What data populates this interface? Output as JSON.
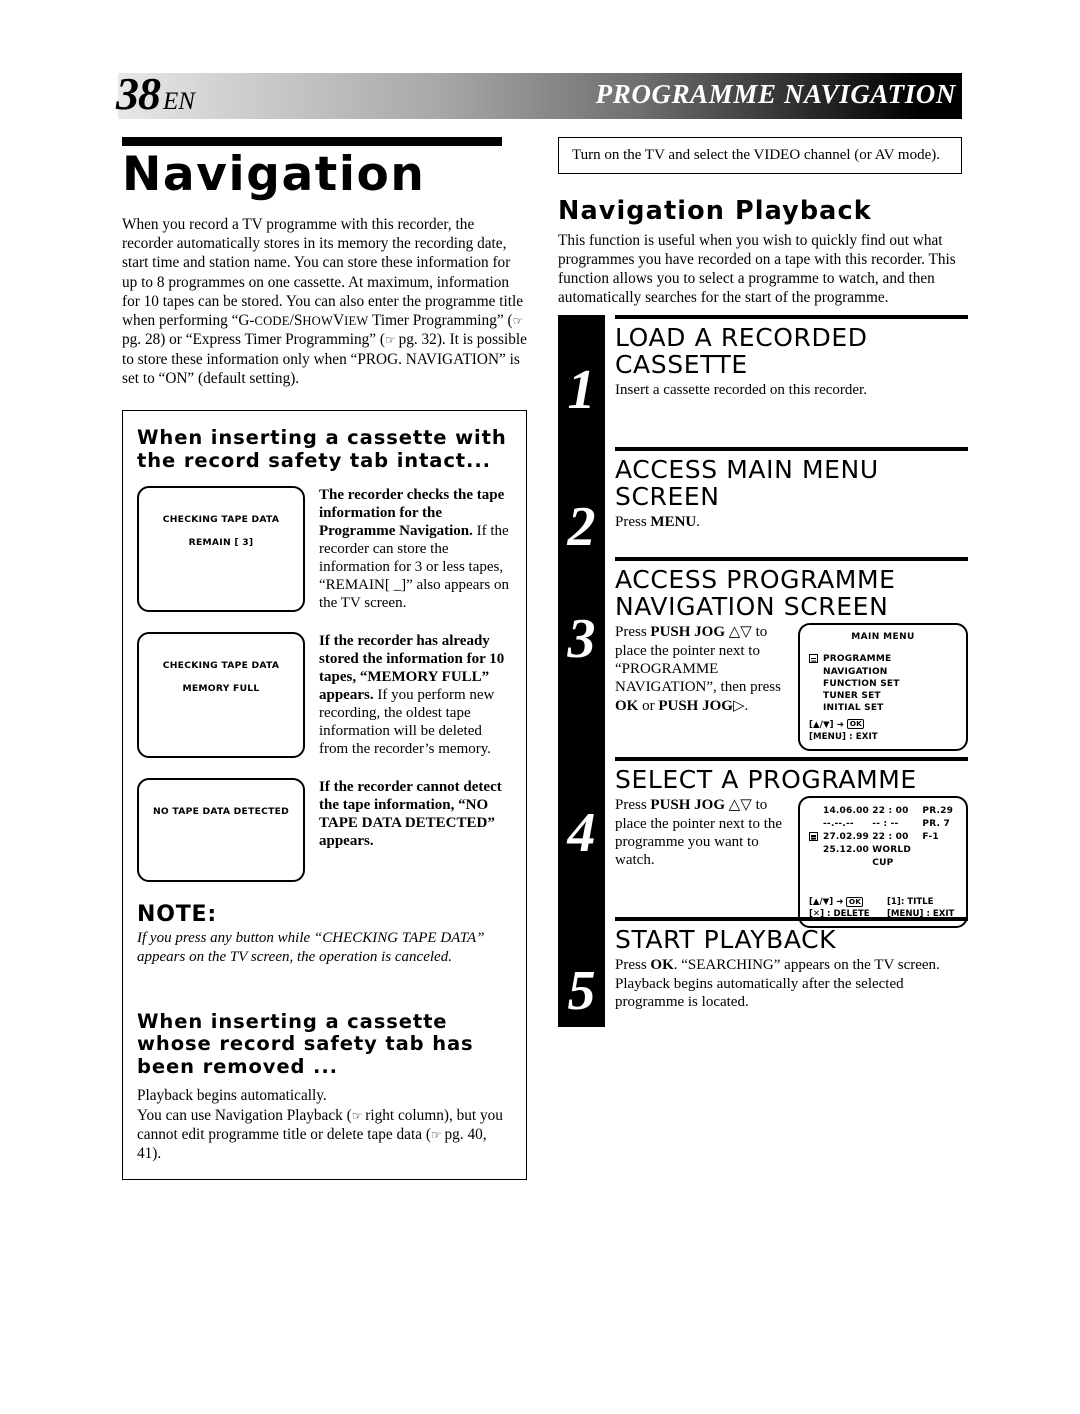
{
  "header": {
    "page_number": "38",
    "lang": "EN",
    "title": "PROGRAMME NAVIGATION"
  },
  "left": {
    "chapter_title": "Navigation",
    "intro_part1": "When you record a TV programme with this recorder, the recorder automatically stores in its memory the recording date, start time and station name. You can store these information for up to 8 programmes on one cassette. At maximum, information for 10 tapes can be stored. You can also enter the programme title when performing “G-",
    "intro_sc1": "CODE",
    "intro_mid1": "/S",
    "intro_sc2": "HOW",
    "intro_mid2": "V",
    "intro_sc3": "IEW",
    "intro_part2": " Timer Programming” (",
    "intro_part3": " pg. 28) or “Express Timer Programming” (",
    "intro_part4": " pg. 32). It is possible to store these information only when “PROG. NAVIGATION” is set to “ON” (default setting).",
    "box": {
      "heading": "When inserting a cassette with the record safety tab intact...",
      "cases": [
        {
          "screen_line1": "CHECKING TAPE DATA",
          "screen_line2": "REMAIN [ 3]",
          "bold_text": "The recorder checks the tape information for the Programme Navigation.",
          "normal_text": "If the recorder can store the information for 3 or less tapes, “REMAIN[ _]” also appears on the TV screen."
        },
        {
          "screen_line1": "CHECKING TAPE DATA",
          "screen_line2": "MEMORY FULL",
          "bold_text": "If the recorder has already stored the information for 10 tapes, “MEMORY FULL” appears.",
          "normal_text": "If you perform new recording, the oldest tape information will be deleted from the recorder’s memory."
        },
        {
          "screen_line1": "NO TAPE DATA DETECTED",
          "screen_line2": "",
          "bold_text": "If the recorder cannot detect the tape information, “NO TAPE DATA DETECTED” appears.",
          "normal_text": ""
        }
      ],
      "note_label": "NOTE:",
      "note_text": "If you press any button while “CHECKING TAPE DATA” appears on the TV screen, the operation is canceled.",
      "heading2": "When inserting a cassette whose record safety tab has been removed ...",
      "body2_part1": "Playback begins automatically.",
      "body2_part2": "You can use Navigation Playback (",
      "body2_part3": " right column), but you cannot edit programme title or delete tape data (",
      "body2_part4": " pg. 40, 41)."
    }
  },
  "right": {
    "tv_note": "Turn on the TV and select the VIDEO channel (or AV mode).",
    "section_title": "Navigation Playback",
    "intro": "This function is useful when you wish to quickly find out what programmes you have recorded on a tape with this recorder. This function allows you to select a programme to watch, and then automatically searches for the start of the programme.",
    "steps": [
      {
        "number": "1",
        "heading": "LOAD A RECORDED CASSETTE",
        "text": "Insert a cassette recorded on this recorder."
      },
      {
        "number": "2",
        "heading": "ACCESS MAIN MENU SCREEN",
        "text_prefix": "Press ",
        "text_bold": "MENU",
        "text_suffix": "."
      },
      {
        "number": "3",
        "heading": "ACCESS PROGRAMME NAVIGATION SCREEN",
        "text": "Press PUSH JOG △▽ to place the pointer next to “PROGRAMME NAVIGATION”, then press OK or PUSH JOG ▷."
      },
      {
        "number": "4",
        "heading": "SELECT A PROGRAMME",
        "text": "Press PUSH JOG △▽ to place the pointer next to the programme you want to watch."
      },
      {
        "number": "5",
        "heading": "START PLAYBACK",
        "text": "Press OK. “SEARCHING” appears on the TV screen. Playback begins automatically after the selected programme is located."
      }
    ],
    "osd_main_menu": {
      "title": "MAIN MENU",
      "items": [
        "PROGRAMME NAVIGATION",
        "FUNCTION SET",
        "TUNER SET",
        "INITIAL SET"
      ],
      "selected_index": 0,
      "footer_line1_pre": "[▲/▼] ➜ ",
      "footer_line1_ok": "OK",
      "footer_line2": "[MENU] : EXIT"
    },
    "osd_programme": {
      "rows": [
        {
          "date": "14.06.00",
          "time": "22 : 00",
          "ch": "PR.29",
          "pointer": false
        },
        {
          "date": "--.--.--",
          "time": "-- : --",
          "ch": "PR.  7",
          "pointer": false
        },
        {
          "date": "27.02.99",
          "time": "22 : 00",
          "ch": "F-1",
          "pointer": true
        },
        {
          "date": "25.12.00",
          "time": "WORLD CUP",
          "ch": "",
          "pointer": false
        }
      ],
      "footer_a1_pre": "[▲/▼] ➜ ",
      "footer_a1_ok": "OK",
      "footer_a2": "[✕] : DELETE",
      "footer_b1": "[1]: TITLE",
      "footer_b2": "[MENU] : EXIT"
    }
  }
}
